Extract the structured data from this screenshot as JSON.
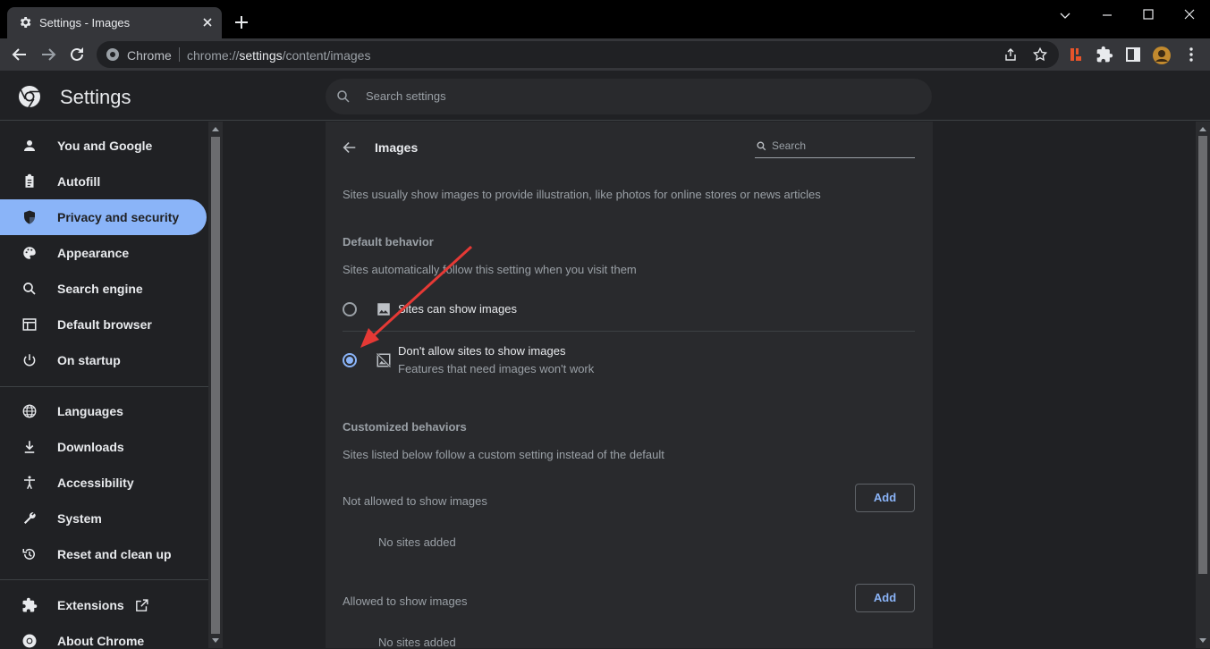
{
  "tab": {
    "title": "Settings - Images"
  },
  "address_bar": {
    "site_name": "Chrome",
    "url_prefix": "chrome://",
    "url_host": "settings",
    "url_path": "/content/images"
  },
  "header": {
    "title": "Settings",
    "search_placeholder": "Search settings"
  },
  "sidebar": {
    "items": [
      {
        "label": "You and Google",
        "icon": "person-icon"
      },
      {
        "label": "Autofill",
        "icon": "clipboard-icon"
      },
      {
        "label": "Privacy and security",
        "icon": "shield-icon",
        "active": true
      },
      {
        "label": "Appearance",
        "icon": "palette-icon"
      },
      {
        "label": "Search engine",
        "icon": "search-icon"
      },
      {
        "label": "Default browser",
        "icon": "browser-icon"
      },
      {
        "label": "On startup",
        "icon": "power-icon"
      },
      {
        "label": "Languages",
        "icon": "globe-icon"
      },
      {
        "label": "Downloads",
        "icon": "download-icon"
      },
      {
        "label": "Accessibility",
        "icon": "accessibility-icon"
      },
      {
        "label": "System",
        "icon": "wrench-icon"
      },
      {
        "label": "Reset and clean up",
        "icon": "history-icon"
      },
      {
        "label": "Extensions",
        "icon": "puzzle-icon"
      },
      {
        "label": "About Chrome",
        "icon": "chrome-icon"
      }
    ]
  },
  "page": {
    "title": "Images",
    "search_placeholder": "Search",
    "description": "Sites usually show images to provide illustration, like photos for online stores or news articles",
    "default_behavior": {
      "heading": "Default behavior",
      "subtext": "Sites automatically follow this setting when you visit them",
      "options": [
        {
          "label": "Sites can show images",
          "sublabel": "",
          "checked": false
        },
        {
          "label": "Don't allow sites to show images",
          "sublabel": "Features that need images won't work",
          "checked": true
        }
      ]
    },
    "customized": {
      "heading": "Customized behaviors",
      "subtext": "Sites listed below follow a custom setting instead of the default",
      "not_allowed": {
        "label": "Not allowed to show images",
        "button": "Add",
        "empty": "No sites added"
      },
      "allowed": {
        "label": "Allowed to show images",
        "button": "Add",
        "empty": "No sites added"
      }
    }
  },
  "colors": {
    "accent": "#8ab4f8",
    "annotation_arrow": "#e53935"
  }
}
